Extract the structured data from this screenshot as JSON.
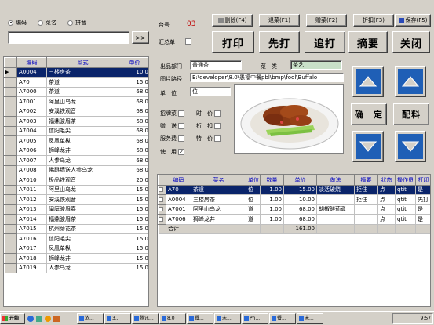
{
  "search": {
    "options": [
      "编码",
      "菜名",
      "拼音"
    ],
    "selected": 0,
    "input_value": "",
    "go_label": ">>"
  },
  "header": {
    "table_label": "台号",
    "table_no": "03",
    "summary_label": "汇总单"
  },
  "toolbar_small": [
    {
      "label": "删除(F4)",
      "name": "delete-button"
    },
    {
      "label": "退菜(F1)",
      "name": "return-dish-button"
    },
    {
      "label": "赠菜(F2)",
      "name": "gift-dish-button"
    },
    {
      "label": "折扣(F3)",
      "name": "discount-button"
    },
    {
      "label": "保存(F5)",
      "name": "save-button"
    }
  ],
  "toolbar_big": [
    {
      "label": "打印",
      "name": "print-button"
    },
    {
      "label": "先打",
      "name": "print-first-button"
    },
    {
      "label": "追打",
      "name": "print-add-button"
    },
    {
      "label": "摘要",
      "name": "summary-button"
    },
    {
      "label": "关闭",
      "name": "close-button"
    }
  ],
  "menu_list": {
    "columns": [
      "编码",
      "菜式",
      "单价"
    ],
    "rows": [
      {
        "code": "A0004",
        "name": "三楼房茶",
        "price": "10.0",
        "selected": true
      },
      {
        "code": "A70",
        "name": "茶道",
        "price": "15.0"
      },
      {
        "code": "A7000",
        "name": "茶道",
        "price": "68.0"
      },
      {
        "code": "A7001",
        "name": "阿里山乌龙",
        "price": "68.0"
      },
      {
        "code": "A7002",
        "name": "安溪铁观音",
        "price": "68.0"
      },
      {
        "code": "A7003",
        "name": "福鼎骏眉茶",
        "price": "68.0"
      },
      {
        "code": "A7004",
        "name": "信阳毛尖",
        "price": "68.0"
      },
      {
        "code": "A7005",
        "name": "凤凰单枞",
        "price": "68.0"
      },
      {
        "code": "A7006",
        "name": "狮峰龙井",
        "price": "68.0"
      },
      {
        "code": "A7007",
        "name": "人参乌龙",
        "price": "68.0"
      },
      {
        "code": "A7008",
        "name": "佛跳墙送人参乌龙",
        "price": "68.0"
      },
      {
        "code": "A7010",
        "name": "极品铁观音",
        "price": "20.0"
      },
      {
        "code": "A7011",
        "name": "阿里山乌龙",
        "price": "15.0"
      },
      {
        "code": "A7012",
        "name": "安溪铁观音",
        "price": "15.0"
      },
      {
        "code": "A7013",
        "name": "闽庭骏眉春",
        "price": "15.0"
      },
      {
        "code": "A7014",
        "name": "福鼎骏眉茶",
        "price": "15.0"
      },
      {
        "code": "A7015",
        "name": "杭州菊花茶",
        "price": "15.0"
      },
      {
        "code": "A7016",
        "name": "信阳毛尖",
        "price": "15.0"
      },
      {
        "code": "A7017",
        "name": "凤凰单枞",
        "price": "15.0"
      },
      {
        "code": "A7018",
        "name": "狮峰龙井",
        "price": "15.0"
      },
      {
        "code": "A7019",
        "name": "人参乌龙",
        "price": "15.0"
      }
    ]
  },
  "detail": {
    "dept_label": "出品部门",
    "dept_value": "普通茶",
    "category_label": "菜　类",
    "category_value": "茶艺",
    "image_path_label": "图片路径",
    "image_path_value": "E:\\developer\\8.0\\愚福中餐pbl\\bmp\\fool\\Buffalo",
    "unit_label": "单　位",
    "unit_value": "位",
    "flags": [
      {
        "label": "招牌菜",
        "name": "signature-dish-checkbox"
      },
      {
        "label": "时　价",
        "name": "market-price-checkbox"
      },
      {
        "label": "赠　送",
        "name": "gift-checkbox"
      },
      {
        "label": "折　扣",
        "name": "discount-checkbox"
      },
      {
        "label": "服务费",
        "name": "service-fee-checkbox"
      },
      {
        "label": "特　价",
        "name": "special-price-checkbox"
      }
    ],
    "use_label": "使　用",
    "use_checked": true
  },
  "side_buttons": {
    "confirm": "确　定",
    "ingredients": "配料"
  },
  "order_table": {
    "columns": [
      "编码",
      "菜名",
      "单位",
      "数量",
      "单价",
      "做法",
      "摘要",
      "状态",
      "操作员",
      "打印"
    ],
    "rows": [
      {
        "code": "A70",
        "name": "茶道",
        "unit": "位",
        "qty": "1.00",
        "price": "15.00",
        "method": "淡活破烧",
        "note": "拒住",
        "status": "点",
        "operator": "qtit",
        "print": "是",
        "selected": true
      },
      {
        "code": "A0004",
        "name": "三楼房茶",
        "unit": "位",
        "qty": "1.00",
        "price": "10.00",
        "method": "",
        "note": "拒住",
        "status": "点",
        "operator": "qtit",
        "print": "先打"
      },
      {
        "code": "A7001",
        "name": "阿里山乌龙",
        "unit": "道",
        "qty": "1.00",
        "price": "68.00",
        "method": "胡椒鲜茄煮",
        "note": "",
        "status": "点",
        "operator": "qtit",
        "print": "是"
      },
      {
        "code": "A7006",
        "name": "狮峰龙井",
        "unit": "道",
        "qty": "1.00",
        "price": "68.00",
        "method": "",
        "note": "",
        "status": "点",
        "operator": "qtit",
        "print": "是"
      }
    ],
    "total_label": "合计",
    "total_value": "161.00"
  },
  "taskbar": {
    "start_label": "开始",
    "items": [
      "浓...",
      "3...",
      "腾讯...",
      "8.0",
      "餐...",
      "未...",
      "Ph...",
      "餐...",
      "未..."
    ],
    "clock": "9:57"
  },
  "colors": {
    "face": "#d4d0c8",
    "selection": "#0a246a",
    "nav_blue": "#1f5fb6",
    "header_text": "#0000c0",
    "readonly_field": "#c8e0c8"
  }
}
